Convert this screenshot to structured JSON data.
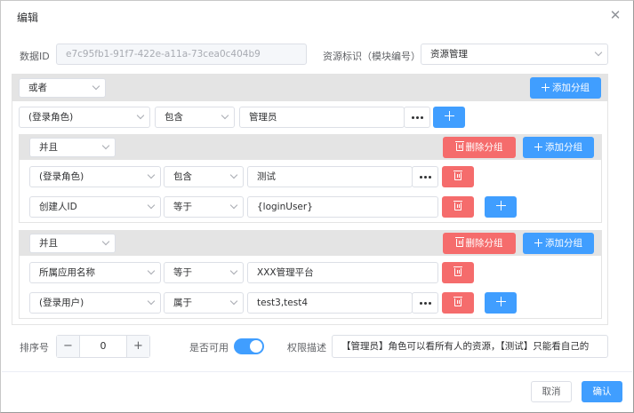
{
  "dialog": {
    "title": "编辑"
  },
  "form": {
    "data_id_label": "数据ID",
    "data_id_value": "e7c95fb1-91f7-422e-a11a-73cea0c404b9",
    "resource_label": "资源标识（模块编号）",
    "resource_value": "资源管理"
  },
  "root_group": {
    "operator": "或者",
    "add_group_label": "添加分组",
    "condition": {
      "field": "(登录角色)",
      "op": "包含",
      "value": "管理员"
    }
  },
  "subgroups": [
    {
      "operator": "并且",
      "delete_label": "删除分组",
      "add_label": "添加分组",
      "conditions": [
        {
          "field": "(登录角色)",
          "op": "包含",
          "value": "测试"
        },
        {
          "field": "创建人ID",
          "op": "等于",
          "value": "{loginUser}"
        }
      ]
    },
    {
      "operator": "并且",
      "delete_label": "删除分组",
      "add_label": "添加分组",
      "conditions": [
        {
          "field": "所属应用名称",
          "op": "等于",
          "value": "XXX管理平台"
        },
        {
          "field": "(登录用户)",
          "op": "属于",
          "value": "test3,test4"
        }
      ]
    }
  ],
  "bottom": {
    "sort_label": "排序号",
    "sort_minus": "−",
    "sort_value": "0",
    "sort_plus": "+",
    "enabled_label": "是否可用",
    "enabled_on": true,
    "desc_label": "权限描述",
    "desc_value": "【管理员】角色可以看所有人的资源，【测试】只能看自己的"
  },
  "footer": {
    "cancel": "取消",
    "confirm": "确认"
  },
  "colors": {
    "primary": "#409eff",
    "danger": "#f56c6c"
  }
}
